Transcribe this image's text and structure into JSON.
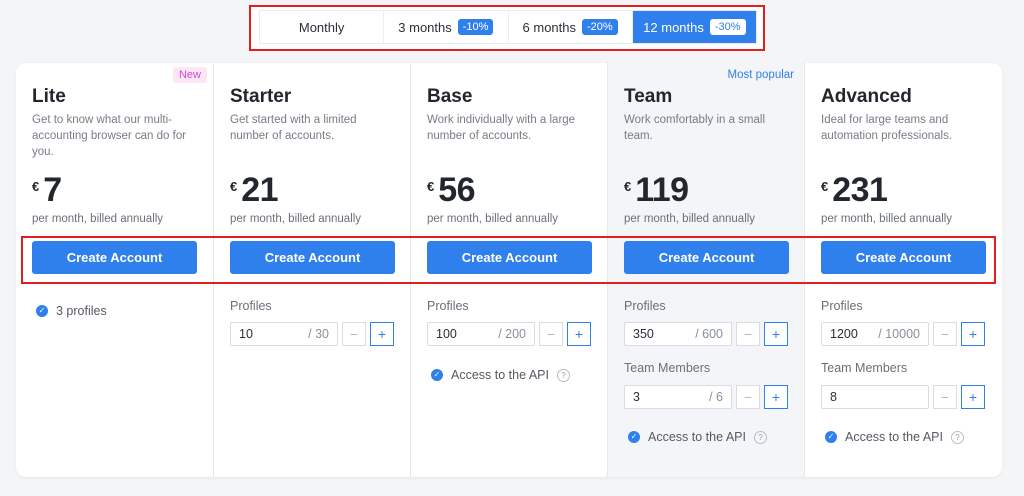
{
  "billing_tabs": [
    {
      "label": "Monthly",
      "badge": ""
    },
    {
      "label": "3 months",
      "badge": "-10%"
    },
    {
      "label": "6 months",
      "badge": "-20%"
    },
    {
      "label": "12 months",
      "badge": "-30%",
      "active": true
    }
  ],
  "plans": [
    {
      "name": "Lite",
      "tag": "New",
      "description": "Get to know what our multi-accounting browser can do for you.",
      "currency": "€",
      "price": "7",
      "billing": "per month, billed annually",
      "cta": "Create Account",
      "feature": "3 profiles"
    },
    {
      "name": "Starter",
      "description": "Get started with a limited number of accounts.",
      "currency": "€",
      "price": "21",
      "billing": "per month, billed annually",
      "cta": "Create Account",
      "profiles_label": "Profiles",
      "profiles_value": "10",
      "profiles_max": "/ 30"
    },
    {
      "name": "Base",
      "description": "Work individually with a large number of accounts.",
      "currency": "€",
      "price": "56",
      "billing": "per month, billed annually",
      "cta": "Create Account",
      "profiles_label": "Profiles",
      "profiles_value": "100",
      "profiles_max": "/ 200",
      "api_label": "Access to the API"
    },
    {
      "name": "Team",
      "tag": "Most popular",
      "description": "Work comfortably in a small team.",
      "currency": "€",
      "price": "119",
      "billing": "per month, billed annually",
      "cta": "Create Account",
      "profiles_label": "Profiles",
      "profiles_value": "350",
      "profiles_max": "/ 600",
      "members_label": "Team Members",
      "members_value": "3",
      "members_max": "/ 6",
      "api_label": "Access to the API"
    },
    {
      "name": "Advanced",
      "description": "Ideal for large teams and automation professionals.",
      "currency": "€",
      "price": "231",
      "billing": "per month, billed annually",
      "cta": "Create Account",
      "profiles_label": "Profiles",
      "profiles_value": "1200",
      "profiles_max": "/ 10000",
      "members_label": "Team Members",
      "members_value": "8",
      "api_label": "Access to the API"
    }
  ],
  "icons": {
    "check": "✓",
    "help": "?",
    "minus": "−",
    "plus": "+"
  },
  "colors": {
    "accent": "#2f80ed",
    "highlight_outline": "#e02020",
    "new_tag": "#d24bd3"
  }
}
